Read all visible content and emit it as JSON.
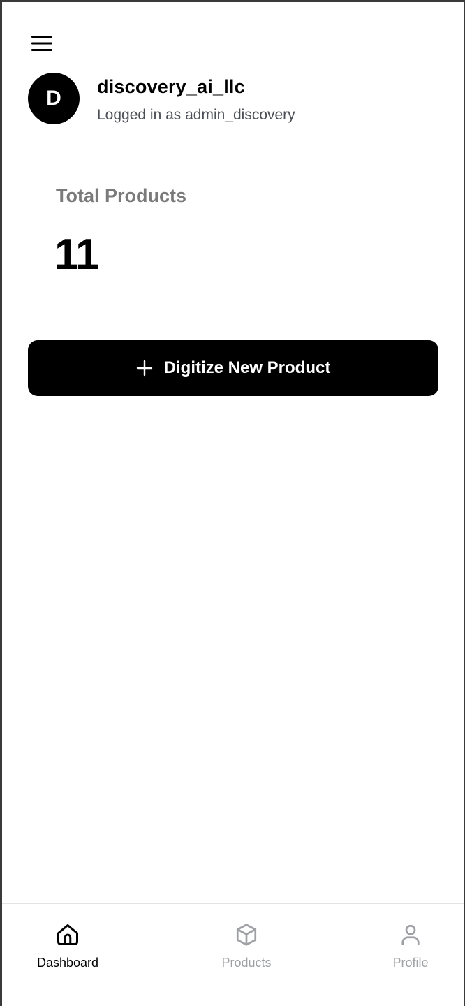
{
  "header": {
    "menu_icon": "hamburger-menu-icon"
  },
  "account": {
    "avatar_initial": "D",
    "org_name": "discovery_ai_llc",
    "login_text": "Logged in as admin_discovery"
  },
  "stats": {
    "total_products_label": "Total Products",
    "total_products_value": "11"
  },
  "actions": {
    "digitize_label": "Digitize New Product",
    "digitize_icon": "plus-icon"
  },
  "bottom_nav": {
    "items": [
      {
        "label": "Dashboard",
        "icon": "home-icon",
        "active": true
      },
      {
        "label": "Products",
        "icon": "box-icon",
        "active": false
      },
      {
        "label": "Profile",
        "icon": "user-icon",
        "active": false
      }
    ]
  },
  "colors": {
    "primary": "#000000",
    "background": "#ffffff",
    "muted_text": "#7a7a7a",
    "inactive_nav": "#9ea0a4"
  }
}
